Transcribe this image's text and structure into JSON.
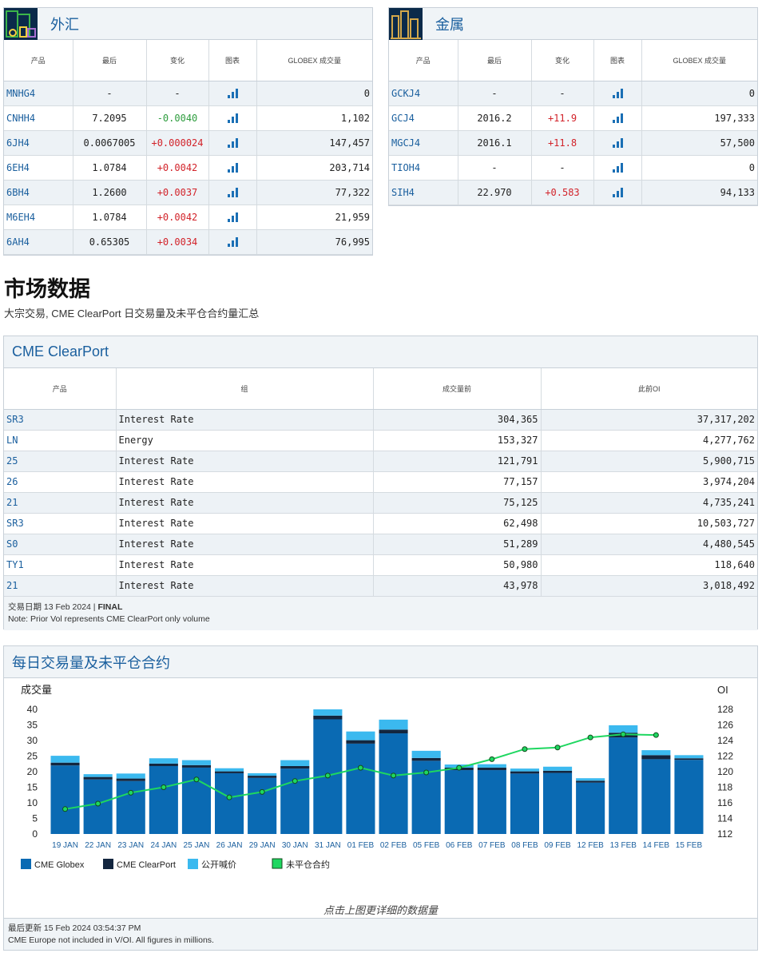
{
  "fx": {
    "title": "外汇",
    "headers": [
      "产品",
      "最后",
      "变化",
      "图表",
      "GLOBEX 成交量"
    ],
    "rows": [
      {
        "product": "MNHG4",
        "last": "-",
        "change": "-",
        "dir": "none",
        "volume": "0"
      },
      {
        "product": "CNHH4",
        "last": "7.2095",
        "change": "-0.0040",
        "dir": "neg",
        "volume": "1,102"
      },
      {
        "product": "6JH4",
        "last": "0.0067005",
        "change": "+0.000024",
        "dir": "pos",
        "volume": "147,457"
      },
      {
        "product": "6EH4",
        "last": "1.0784",
        "change": "+0.0042",
        "dir": "pos",
        "volume": "203,714"
      },
      {
        "product": "6BH4",
        "last": "1.2600",
        "change": "+0.0037",
        "dir": "pos",
        "volume": "77,322"
      },
      {
        "product": "M6EH4",
        "last": "1.0784",
        "change": "+0.0042",
        "dir": "pos",
        "volume": "21,959"
      },
      {
        "product": "6AH4",
        "last": "0.65305",
        "change": "+0.0034",
        "dir": "pos",
        "volume": "76,995"
      }
    ]
  },
  "metals": {
    "title": "金属",
    "headers": [
      "产品",
      "最后",
      "变化",
      "图表",
      "GLOBEX 成交量"
    ],
    "rows": [
      {
        "product": "GCKJ4",
        "last": "-",
        "change": "-",
        "dir": "none",
        "volume": "0"
      },
      {
        "product": "GCJ4",
        "last": "2016.2",
        "change": "+11.9",
        "dir": "pos",
        "volume": "197,333"
      },
      {
        "product": "MGCJ4",
        "last": "2016.1",
        "change": "+11.8",
        "dir": "pos",
        "volume": "57,500"
      },
      {
        "product": "TIOH4",
        "last": "-",
        "change": "-",
        "dir": "none",
        "volume": "0"
      },
      {
        "product": "SIH4",
        "last": "22.970",
        "change": "+0.583",
        "dir": "pos",
        "volume": "94,133"
      }
    ]
  },
  "market": {
    "heading": "市场数据",
    "subheading": "大宗交易, CME ClearPort 日交易量及未平仓合约量汇总"
  },
  "clearport": {
    "title": "CME ClearPort",
    "headers": [
      "产品",
      "组",
      "成交量前",
      "此前OI"
    ],
    "rows": [
      {
        "product": "SR3",
        "group": "Interest Rate",
        "volume": "304,365",
        "oi": "37,317,202"
      },
      {
        "product": "LN",
        "group": "Energy",
        "volume": "153,327",
        "oi": "4,277,762"
      },
      {
        "product": "25",
        "group": "Interest Rate",
        "volume": "121,791",
        "oi": "5,900,715"
      },
      {
        "product": "26",
        "group": "Interest Rate",
        "volume": "77,157",
        "oi": "3,974,204"
      },
      {
        "product": "21",
        "group": "Interest Rate",
        "volume": "75,125",
        "oi": "4,735,241"
      },
      {
        "product": "SR3",
        "group": "Interest Rate",
        "volume": "62,498",
        "oi": "10,503,727"
      },
      {
        "product": "S0",
        "group": "Interest Rate",
        "volume": "51,289",
        "oi": "4,480,545"
      },
      {
        "product": "TY1",
        "group": "Interest Rate",
        "volume": "50,980",
        "oi": "118,640"
      },
      {
        "product": "21",
        "group": "Interest Rate",
        "volume": "43,978",
        "oi": "3,018,492"
      }
    ],
    "trade_date_label": "交易日期 13 Feb 2024 | ",
    "trade_date_status": "FINAL",
    "note": "Note: Prior Vol represents CME ClearPort only volume"
  },
  "daily": {
    "title": "每日交易量及未平仓合约",
    "click_hint": "点击上图更详细的数据量",
    "updated": "最后更新 15 Feb 2024 03:54:37 PM",
    "note": "CME Europe not included in V/OI. All figures in millions."
  },
  "chart_data": {
    "type": "bar",
    "stacked": true,
    "ylabel": "成交量",
    "y2label": "OI",
    "ylim": [
      0,
      40
    ],
    "yticks": [
      0,
      5,
      10,
      15,
      20,
      25,
      30,
      35,
      40
    ],
    "y2lim": [
      112,
      128
    ],
    "y2ticks": [
      112,
      114,
      116,
      118,
      120,
      122,
      124,
      126,
      128
    ],
    "categories": [
      "19 JAN",
      "22 JAN",
      "23 JAN",
      "24 JAN",
      "25 JAN",
      "26 JAN",
      "29 JAN",
      "30 JAN",
      "31 JAN",
      "01 FEB",
      "02 FEB",
      "05 FEB",
      "06 FEB",
      "07 FEB",
      "08 FEB",
      "09 FEB",
      "12 FEB",
      "13 FEB",
      "14 FEB",
      "15 FEB"
    ],
    "series": [
      {
        "name": "CME Globex",
        "color": "#0a6ab3",
        "values": [
          22,
          17.5,
          17,
          21.8,
          21.3,
          19.5,
          18,
          21,
          36.8,
          29,
          32.3,
          23.5,
          20.5,
          20.5,
          19.4,
          19.6,
          16.5,
          31,
          24,
          23.8
        ]
      },
      {
        "name": "CME ClearPort",
        "color": "#13263f",
        "values": [
          0.9,
          0.8,
          0.8,
          0.8,
          0.8,
          0.6,
          0.7,
          0.8,
          1.2,
          1.1,
          1.2,
          0.9,
          0.8,
          0.8,
          0.7,
          0.7,
          0.6,
          1.5,
          1.3,
          0.5
        ]
      },
      {
        "name": "公开喊价",
        "color": "#3bb9ef",
        "values": [
          2.2,
          0.9,
          1.6,
          1.7,
          1.6,
          1.0,
          0.8,
          1.9,
          2.0,
          2.8,
          3.2,
          2.3,
          1.0,
          1.1,
          0.9,
          1.3,
          0.8,
          2.4,
          1.6,
          1.0
        ]
      },
      {
        "name": "未平仓合约",
        "type": "line",
        "color": "#1ed760",
        "values": [
          115.2,
          115.9,
          117.3,
          118.0,
          119.0,
          116.7,
          117.4,
          118.8,
          119.5,
          120.5,
          119.5,
          119.9,
          120.5,
          121.6,
          122.9,
          123.1,
          124.4,
          124.8,
          124.7,
          null
        ]
      }
    ],
    "legend_position": "bottom-left",
    "grid": false
  }
}
